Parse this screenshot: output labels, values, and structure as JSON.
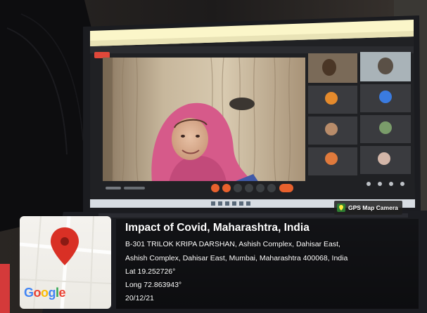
{
  "overlay": {
    "title": "Impact of Covid, Maharashtra, India",
    "address_line1": "B-301 TRILOK KRIPA DARSHAN, Ashish Complex, Dahisar East,",
    "address_line2": "Ashish Complex, Dahisar East, Mumbai, Maharashtra 400068, India",
    "lat": "Lat 19.252726°",
    "long": "Long 72.863943°",
    "date": "20/12/21",
    "badge_label": "GPS Map Camera",
    "map_logo": [
      "G",
      "o",
      "o",
      "g",
      "l",
      "e"
    ],
    "map_logo_colors": [
      "#4285F4",
      "#EA4335",
      "#FBBC05",
      "#4285F4",
      "#34A853",
      "#EA4335"
    ]
  },
  "colors": {
    "map_pin": "#d93025",
    "meet_toolbar_buttons": "#e8612d",
    "headscarf": "#d65a8a"
  }
}
